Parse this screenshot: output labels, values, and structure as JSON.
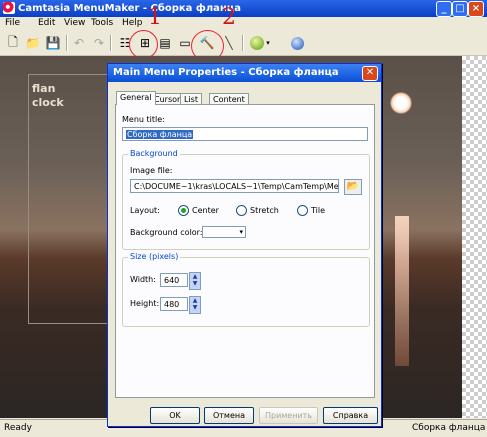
{
  "window": {
    "title": "Camtasia MenuMaker - Сборка фланца"
  },
  "menubar": [
    "File",
    "Edit",
    "View",
    "Tools",
    "Help"
  ],
  "annotations": {
    "label1": "1",
    "label2": "2"
  },
  "preview": {
    "line1": "flan",
    "line2": "clock"
  },
  "statusbar": {
    "left": "Ready",
    "right": "Сборка фланца"
  },
  "dialog": {
    "title": "Main Menu Properties - Сборка фланца",
    "tabs": [
      "General",
      "Cursor",
      "List",
      "Content"
    ],
    "menu_title_label": "Menu title:",
    "menu_title_value": "Сборка фланца",
    "background_group": "Background",
    "image_file_label": "Image file:",
    "image_file_value": "C:\\DOCUME~1\\kras\\LOCALS~1\\Temp\\CamTemp\\MenuFil",
    "layout_label": "Layout:",
    "layout_options": [
      "Center",
      "Stretch",
      "Tile"
    ],
    "layout_selected": "Center",
    "bgcolor_label": "Background color:",
    "size_group": "Size (pixels)",
    "width_label": "Width:",
    "width_value": "640",
    "height_label": "Height:",
    "height_value": "480",
    "buttons": {
      "ok": "OK",
      "cancel": "Отмена",
      "apply": "Применить",
      "help": "Справка"
    }
  }
}
